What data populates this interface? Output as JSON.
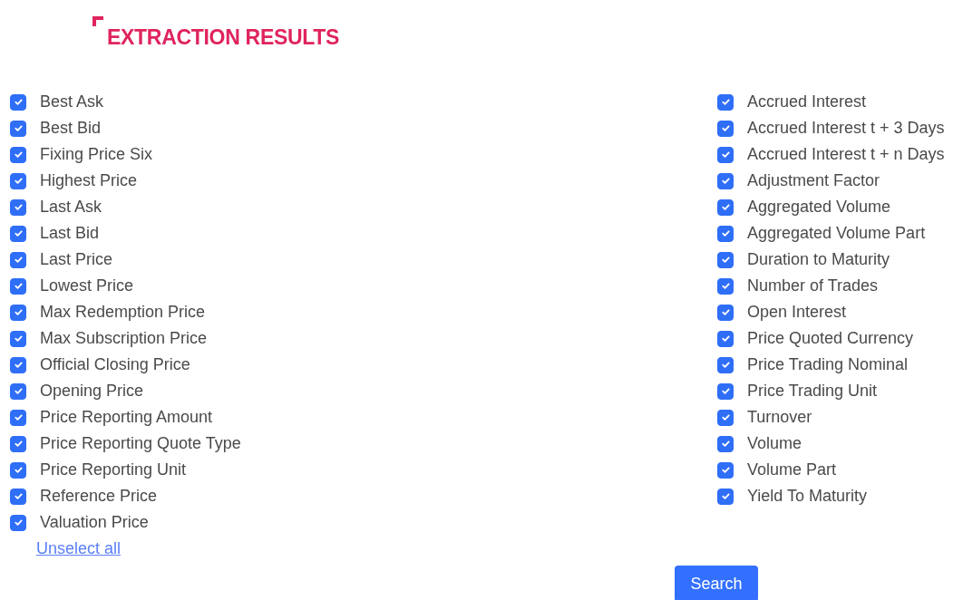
{
  "title": "EXTRACTION RESULTS",
  "columns": [
    {
      "fields": [
        {
          "label": "Best Ask",
          "checked": true
        },
        {
          "label": "Best Bid",
          "checked": true
        },
        {
          "label": "Fixing Price Six",
          "checked": true
        },
        {
          "label": "Highest Price",
          "checked": true
        },
        {
          "label": "Last Ask",
          "checked": true
        },
        {
          "label": "Last Bid",
          "checked": true
        },
        {
          "label": "Last Price",
          "checked": true
        },
        {
          "label": "Lowest Price",
          "checked": true
        },
        {
          "label": "Max Redemption Price",
          "checked": true
        },
        {
          "label": "Max Subscription Price",
          "checked": true
        },
        {
          "label": "Official Closing Price",
          "checked": true
        },
        {
          "label": "Opening Price",
          "checked": true
        },
        {
          "label": "Price Reporting Amount",
          "checked": true
        },
        {
          "label": "Price Reporting Quote Type",
          "checked": true
        },
        {
          "label": "Price Reporting Unit",
          "checked": true
        },
        {
          "label": "Reference Price",
          "checked": true
        },
        {
          "label": "Valuation Price",
          "checked": true
        }
      ]
    },
    {
      "fields": [
        {
          "label": "Accrued Interest",
          "checked": true
        },
        {
          "label": "Accrued Interest t + 3 Days",
          "checked": true
        },
        {
          "label": "Accrued Interest t + n Days",
          "checked": true
        },
        {
          "label": "Adjustment Factor",
          "checked": true
        },
        {
          "label": "Aggregated Volume",
          "checked": true
        },
        {
          "label": "Aggregated Volume Part",
          "checked": true
        },
        {
          "label": "Duration to Maturity",
          "checked": true
        },
        {
          "label": "Number of Trades",
          "checked": true
        },
        {
          "label": "Open Interest",
          "checked": true
        },
        {
          "label": "Price Quoted Currency",
          "checked": true
        },
        {
          "label": "Price Trading Nominal",
          "checked": true
        },
        {
          "label": "Price Trading Unit",
          "checked": true
        },
        {
          "label": "Turnover",
          "checked": true
        },
        {
          "label": "Volume",
          "checked": true
        },
        {
          "label": "Volume Part",
          "checked": true
        },
        {
          "label": "Yield To Maturity",
          "checked": true
        }
      ]
    }
  ],
  "unselect_link": "Unselect all",
  "search_button": "Search"
}
